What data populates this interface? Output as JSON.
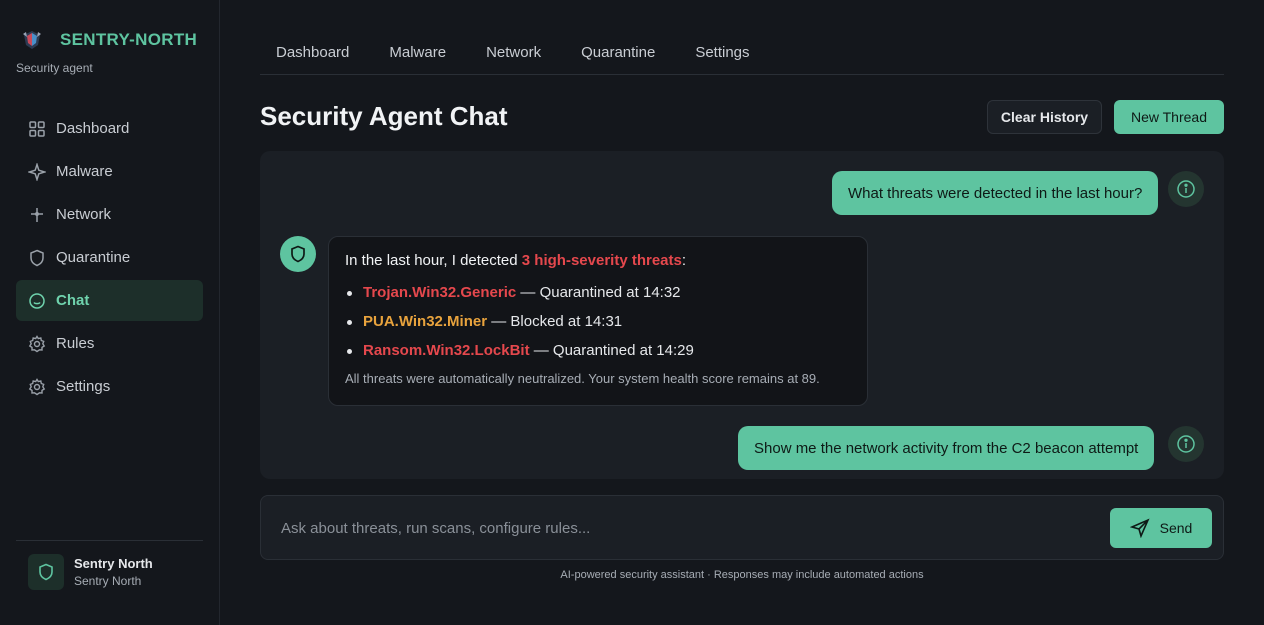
{
  "brand": {
    "name": "SENTRY-NORTH",
    "subtitle": "Security agent"
  },
  "sidebar": {
    "items": [
      {
        "label": "Dashboard",
        "icon": "grid-icon"
      },
      {
        "label": "Malware",
        "icon": "sparkle-icon"
      },
      {
        "label": "Network",
        "icon": "network-icon"
      },
      {
        "label": "Quarantine",
        "icon": "shield-icon"
      },
      {
        "label": "Chat",
        "icon": "chat-smile-icon",
        "active": true
      },
      {
        "label": "Rules",
        "icon": "gear-icon"
      },
      {
        "label": "Settings",
        "icon": "gear-icon"
      }
    ]
  },
  "user": {
    "name": "Sentry North",
    "subtitle": "Sentry North"
  },
  "tabs": [
    "Dashboard",
    "Malware",
    "Network",
    "Quarantine",
    "Settings"
  ],
  "page": {
    "title": "Security Agent Chat"
  },
  "actions": {
    "clear": "Clear History",
    "new": "New Thread"
  },
  "messages": {
    "user1": "What threats were detected in the last hour?",
    "bot": {
      "intro_prefix": "In the last hour, I detected ",
      "intro_highlight": "3 high-severity threats",
      "intro_suffix": ":",
      "threats": [
        {
          "name": "Trojan.Win32.Generic",
          "status": " — Quarantined at 14:32",
          "color": "#e5484d"
        },
        {
          "name": "PUA.Win32.Miner",
          "status": " — Blocked at 14:31",
          "color": "#e8a33d"
        },
        {
          "name": "Ransom.Win32.LockBit",
          "status": " — Quarantined at 14:29",
          "color": "#e5484d"
        }
      ],
      "footer": "All threats were automatically neutralized. Your system health score remains at 89."
    },
    "user2": "Show me the network activity from the C2 beacon attempt"
  },
  "composer": {
    "placeholder": "Ask about threats, run scans, configure rules...",
    "send": "Send"
  },
  "footer_note": "AI-powered security assistant · Responses may include automated actions",
  "colors": {
    "accent": "#5ec4a0",
    "danger": "#e5484d",
    "warning": "#e8a33d"
  }
}
